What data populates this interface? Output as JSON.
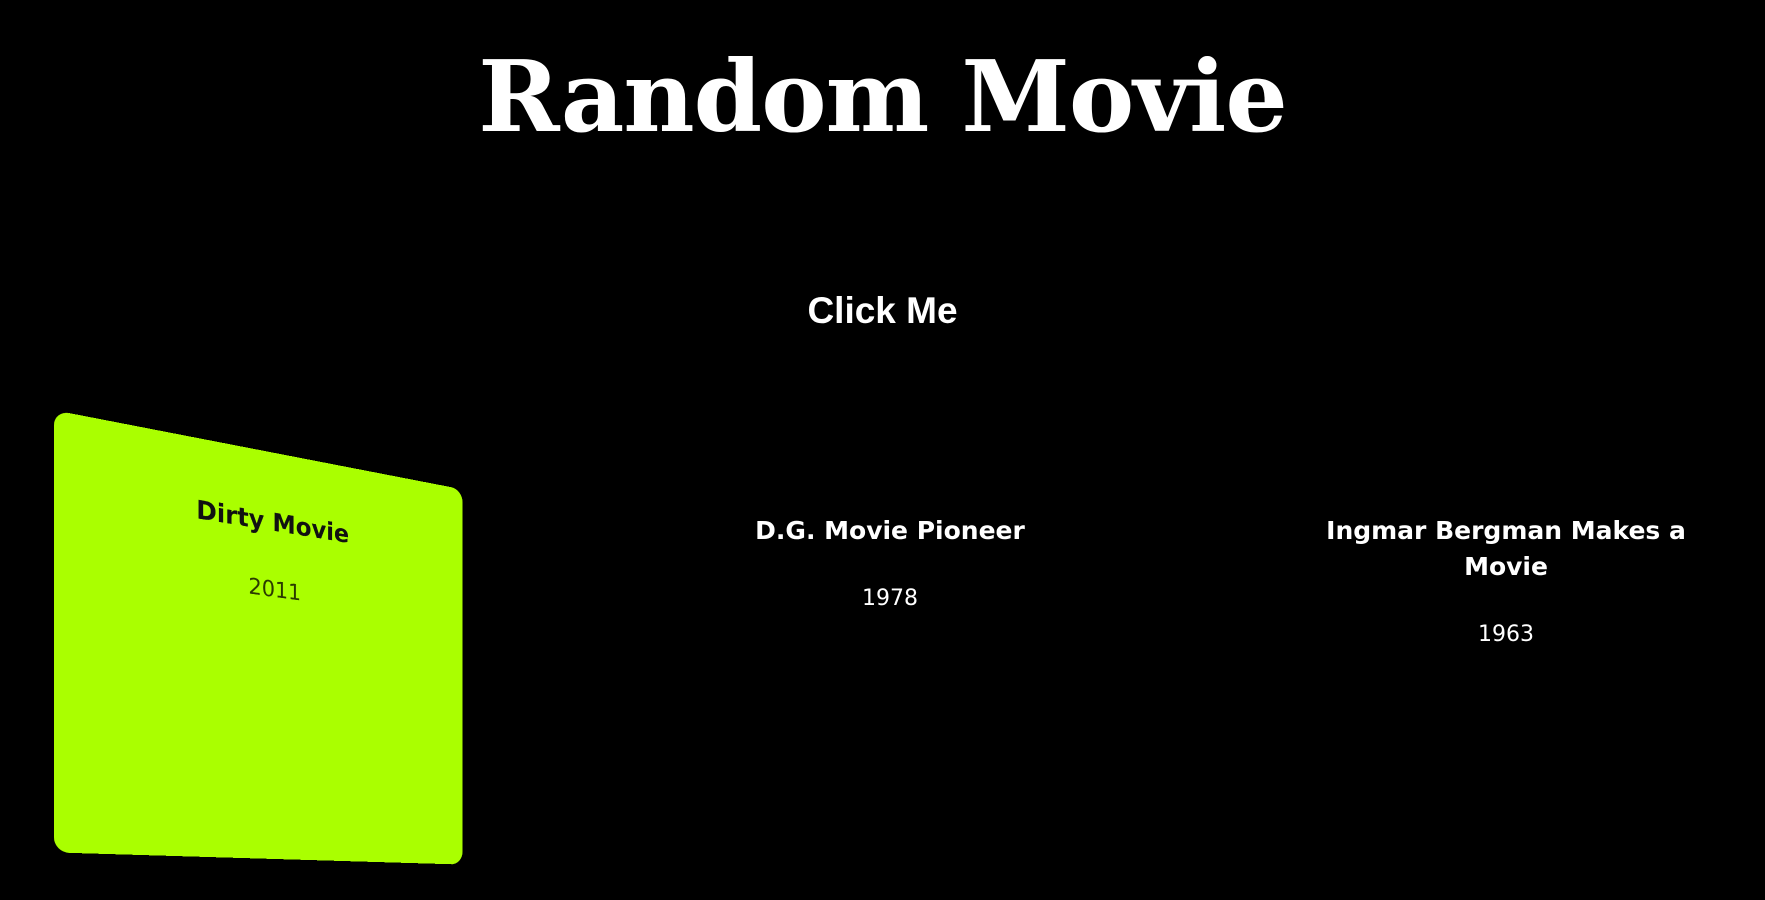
{
  "header": {
    "title": "Random Movie"
  },
  "actions": {
    "click_label": "Click Me"
  },
  "cards": [
    {
      "title": "Dirty Movie",
      "year": "2011",
      "background": "#aaff00"
    },
    {
      "title": "D.G. Movie Pioneer",
      "year": "1978"
    },
    {
      "title": "Ingmar Bergman Makes a Movie",
      "year": "1963"
    }
  ],
  "colors": {
    "background": "#000000",
    "text": "#ffffff",
    "accent": "#aaff00"
  }
}
